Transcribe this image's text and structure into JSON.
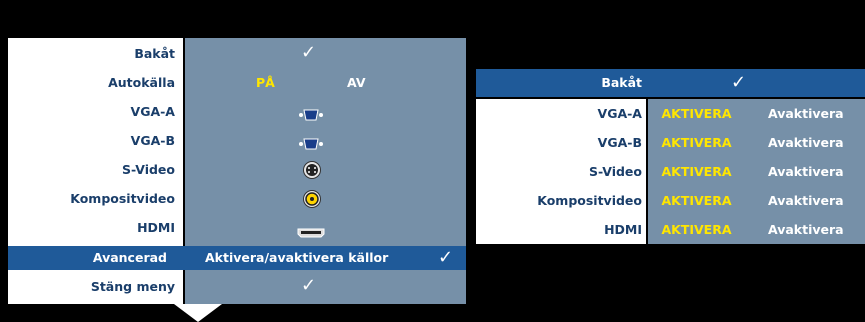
{
  "main_menu": {
    "rows": [
      {
        "label": "Bakåt",
        "value": "✓"
      },
      {
        "label": "Autokälla",
        "on": "PÅ",
        "off": "AV"
      },
      {
        "label": "VGA-A",
        "icon": "vga-connector-icon"
      },
      {
        "label": "VGA-B",
        "icon": "vga-connector-icon"
      },
      {
        "label": "S-Video",
        "icon": "svideo-connector-icon"
      },
      {
        "label": "Kompositvideo",
        "icon": "composite-connector-icon"
      },
      {
        "label": "HDMI",
        "icon": "hdmi-connector-icon"
      },
      {
        "label": "Avancerad",
        "value": "Aktivera/avaktivera källor",
        "check": "✓"
      },
      {
        "label": "Stäng meny",
        "value": "✓"
      }
    ],
    "selected_index": 7
  },
  "submenu": {
    "header": {
      "label": "Bakåt",
      "value": "✓"
    },
    "rows": [
      {
        "label": "VGA-A",
        "on": "AKTIVERA",
        "off": "Avaktivera"
      },
      {
        "label": "VGA-B",
        "on": "AKTIVERA",
        "off": "Avaktivera"
      },
      {
        "label": "S-Video",
        "on": "AKTIVERA",
        "off": "Avaktivera"
      },
      {
        "label": "Kompositvideo",
        "on": "AKTIVERA",
        "off": "Avaktivera"
      },
      {
        "label": "HDMI",
        "on": "AKTIVERA",
        "off": "Avaktivera"
      }
    ]
  },
  "colors": {
    "highlight": "#1f5a99",
    "value_panel": "#7690a8",
    "label_text": "#1a3e6a",
    "active_text": "#ffe600"
  },
  "scroll_indicator": "arrow-down-icon"
}
